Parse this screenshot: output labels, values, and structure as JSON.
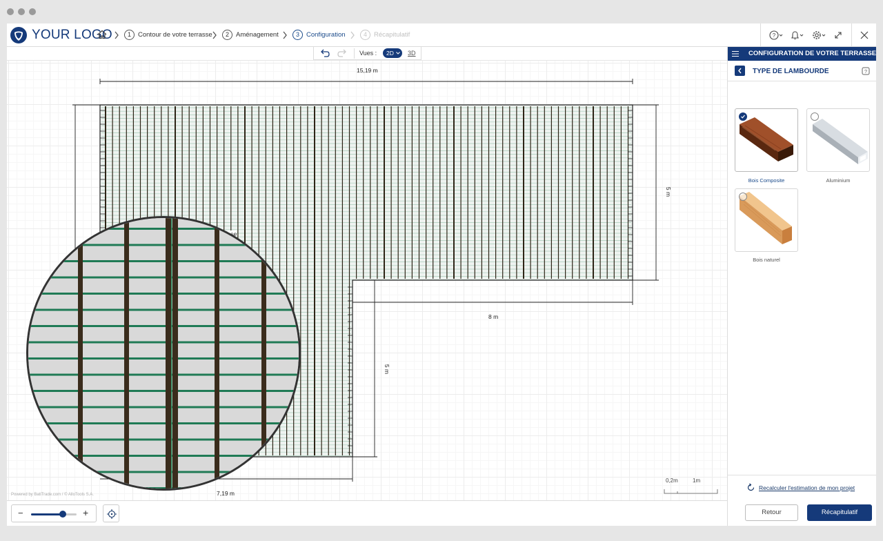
{
  "app": {
    "logo_text": "YOUR LOGO",
    "brand_color": "#153a7a"
  },
  "breadcrumb": {
    "home_icon": "home-icon",
    "steps": [
      {
        "num": "1",
        "label": "Contour de votre terrasse",
        "state": "done"
      },
      {
        "num": "2",
        "label": "Aménagement",
        "state": "done"
      },
      {
        "num": "3",
        "label": "Configuration",
        "state": "active"
      },
      {
        "num": "4",
        "label": "Récapitulatif",
        "state": "disabled"
      }
    ]
  },
  "toolbar": {
    "icons": [
      "help-icon",
      "bell-icon",
      "gear-icon",
      "fullscreen-icon",
      "close-icon"
    ]
  },
  "viewbar": {
    "views_label": "Vues :",
    "view_2d": "2D",
    "view_3d": "3D"
  },
  "canvas": {
    "dimensions": {
      "top_width": "15,19 m",
      "right_height": "5 m",
      "inner_width": "8 m",
      "inner_height": "5 m",
      "bottom_width": "7,19 m"
    },
    "powered_by": "Powered by BatiTrade.com / © AlloTools S.A.",
    "scale": {
      "left": "0,2m",
      "right": "1m"
    },
    "overlay_text": "sse"
  },
  "panel": {
    "header_title": "CONFIGURATION DE VOTRE TERRASSE",
    "section_title": "TYPE DE LAMBOURDE",
    "options": [
      {
        "label": "Bois Composite",
        "selected": true,
        "icon": "composite-joist-image"
      },
      {
        "label": "Aluminium",
        "selected": false,
        "icon": "aluminium-joist-image"
      },
      {
        "label": "Bois naturel",
        "selected": false,
        "icon": "natural-wood-joist-image"
      }
    ],
    "recalc_label": "Recalculer l'estimation de mon projet"
  },
  "bottom": {
    "zoom_minus": "−",
    "zoom_plus": "+",
    "zoom_level": 0.7,
    "retour_label": "Retour",
    "recap_label": "Récapitulatif"
  }
}
